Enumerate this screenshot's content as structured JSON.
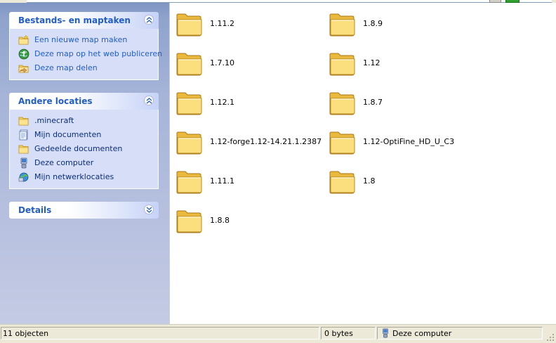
{
  "task_pane": {
    "file_tasks": {
      "title": "Bestands- en maptaken",
      "items": [
        {
          "label": "Een nieuwe map maken",
          "icon": "new-folder-icon"
        },
        {
          "label": "Deze map op het web publiceren",
          "icon": "publish-web-icon"
        },
        {
          "label": "Deze map delen",
          "icon": "share-folder-icon"
        }
      ]
    },
    "other_places": {
      "title": "Andere locaties",
      "items": [
        {
          "label": ".minecraft",
          "icon": "folder-icon"
        },
        {
          "label": "Mijn documenten",
          "icon": "my-documents-icon"
        },
        {
          "label": "Gedeelde documenten",
          "icon": "shared-documents-icon"
        },
        {
          "label": "Deze computer",
          "icon": "computer-icon"
        },
        {
          "label": "Mijn netwerklocaties",
          "icon": "network-places-icon"
        }
      ]
    },
    "details": {
      "title": "Details"
    }
  },
  "folders": [
    {
      "name": "1.11.2"
    },
    {
      "name": "1.8.9"
    },
    {
      "name": "1.7.10"
    },
    {
      "name": "1.12"
    },
    {
      "name": "1.12.1"
    },
    {
      "name": "1.8.7"
    },
    {
      "name": "1.12-forge1.12-14.21.1.2387"
    },
    {
      "name": "1.12-OptiFine_HD_U_C3"
    },
    {
      "name": "1.11.1"
    },
    {
      "name": "1.8"
    },
    {
      "name": "1.8.8"
    }
  ],
  "status_bar": {
    "count": "11 objecten",
    "size": "0 bytes",
    "location": "Deze computer"
  },
  "colors": {
    "task_link": "#215dc6",
    "panel_body": "#d6dff7",
    "folder_yellow": "#f5d670",
    "status_bar": "#ece9d8"
  }
}
